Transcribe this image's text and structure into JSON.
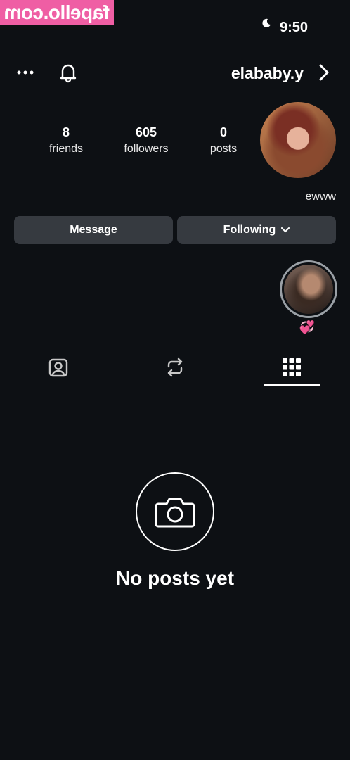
{
  "watermark": "fapello.com",
  "status_bar": {
    "time": "9:50"
  },
  "header": {
    "username": "elababy.y",
    "back_icon": "chevron-left-icon",
    "bell_icon": "bell-icon",
    "more_icon": "more-horizontal-icon"
  },
  "profile": {
    "stats": [
      {
        "value": "0",
        "label": "posts"
      },
      {
        "value": "605",
        "label": "followers"
      },
      {
        "value": "8",
        "label": "friends"
      }
    ],
    "bio": "ewww",
    "buttons": {
      "following": "Following",
      "message": "Message"
    }
  },
  "highlights": [
    {
      "label": "💞"
    }
  ],
  "tabs": [
    {
      "name": "posts-grid",
      "icon": "grid-icon",
      "active": true
    },
    {
      "name": "reposts",
      "icon": "repost-icon",
      "active": false
    },
    {
      "name": "tagged",
      "icon": "tagged-icon",
      "active": false
    }
  ],
  "empty_state": {
    "icon": "camera-icon",
    "text": "No posts yet"
  },
  "colors": {
    "background": "#0d1014",
    "button": "#363a40",
    "watermark": "#ef5ea4"
  }
}
